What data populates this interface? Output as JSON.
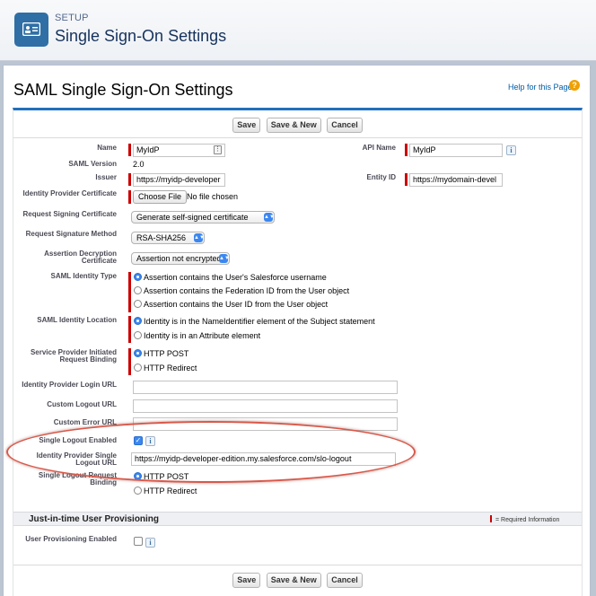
{
  "header": {
    "section_label": "SETUP",
    "title": "Single Sign-On Settings"
  },
  "page": {
    "title": "SAML Single Sign-On Settings",
    "help_link": "Help for this Page",
    "help_icon": "?"
  },
  "buttons": {
    "save": "Save",
    "save_new": "Save & New",
    "cancel": "Cancel"
  },
  "fields": {
    "name": {
      "label": "Name",
      "value": "MyIdP"
    },
    "api_name": {
      "label": "API Name",
      "value": "MyIdP"
    },
    "saml_version": {
      "label": "SAML Version",
      "value": "2.0"
    },
    "issuer": {
      "label": "Issuer",
      "value": "https://myidp-developer"
    },
    "entity_id": {
      "label": "Entity ID",
      "value": "https://mydomain-devel"
    },
    "idp_certificate": {
      "label": "Identity Provider Certificate",
      "button": "Choose File",
      "status": "No file chosen"
    },
    "request_signing_certificate": {
      "label": "Request Signing Certificate",
      "value": "Generate self-signed certificate"
    },
    "request_signature_method": {
      "label": "Request Signature Method",
      "value": "RSA-SHA256"
    },
    "assertion_decryption_certificate": {
      "label": "Assertion Decryption Certificate",
      "value": "Assertion not encrypted"
    },
    "saml_identity_type": {
      "label": "SAML Identity Type",
      "options": [
        "Assertion contains the User's Salesforce username",
        "Assertion contains the Federation ID from the User object",
        "Assertion contains the User ID from the User object"
      ]
    },
    "saml_identity_location": {
      "label": "SAML Identity Location",
      "options": [
        "Identity is in the NameIdentifier element of the Subject statement",
        "Identity is in an Attribute element"
      ]
    },
    "sp_request_binding": {
      "label": "Service Provider Initiated Request Binding",
      "options": [
        "HTTP POST",
        "HTTP Redirect"
      ]
    },
    "idp_login_url": {
      "label": "Identity Provider Login URL",
      "value": ""
    },
    "custom_logout_url": {
      "label": "Custom Logout URL",
      "value": ""
    },
    "custom_error_url": {
      "label": "Custom Error URL",
      "value": ""
    },
    "single_logout_enabled": {
      "label": "Single Logout Enabled",
      "checked": true
    },
    "idp_single_logout_url": {
      "label": "Identity Provider Single Logout URL",
      "value": "https://myidp-developer-edition.my.salesforce.com/slo-logout"
    },
    "single_logout_request_binding": {
      "label": "Single Logout Request Binding",
      "options": [
        "HTTP POST",
        "HTTP Redirect"
      ]
    },
    "user_provisioning_enabled": {
      "label": "User Provisioning Enabled",
      "checked": false
    }
  },
  "jit_section": {
    "title": "Just-in-time User Provisioning",
    "required_legend": "= Required Information"
  },
  "icons": {
    "info": "i",
    "lookup": "⋮",
    "chevron": "▲▼",
    "checkmark": "✓"
  },
  "colors": {
    "required": "#cc0000",
    "accent": "#236fbd",
    "highlight": "#d9594a"
  }
}
